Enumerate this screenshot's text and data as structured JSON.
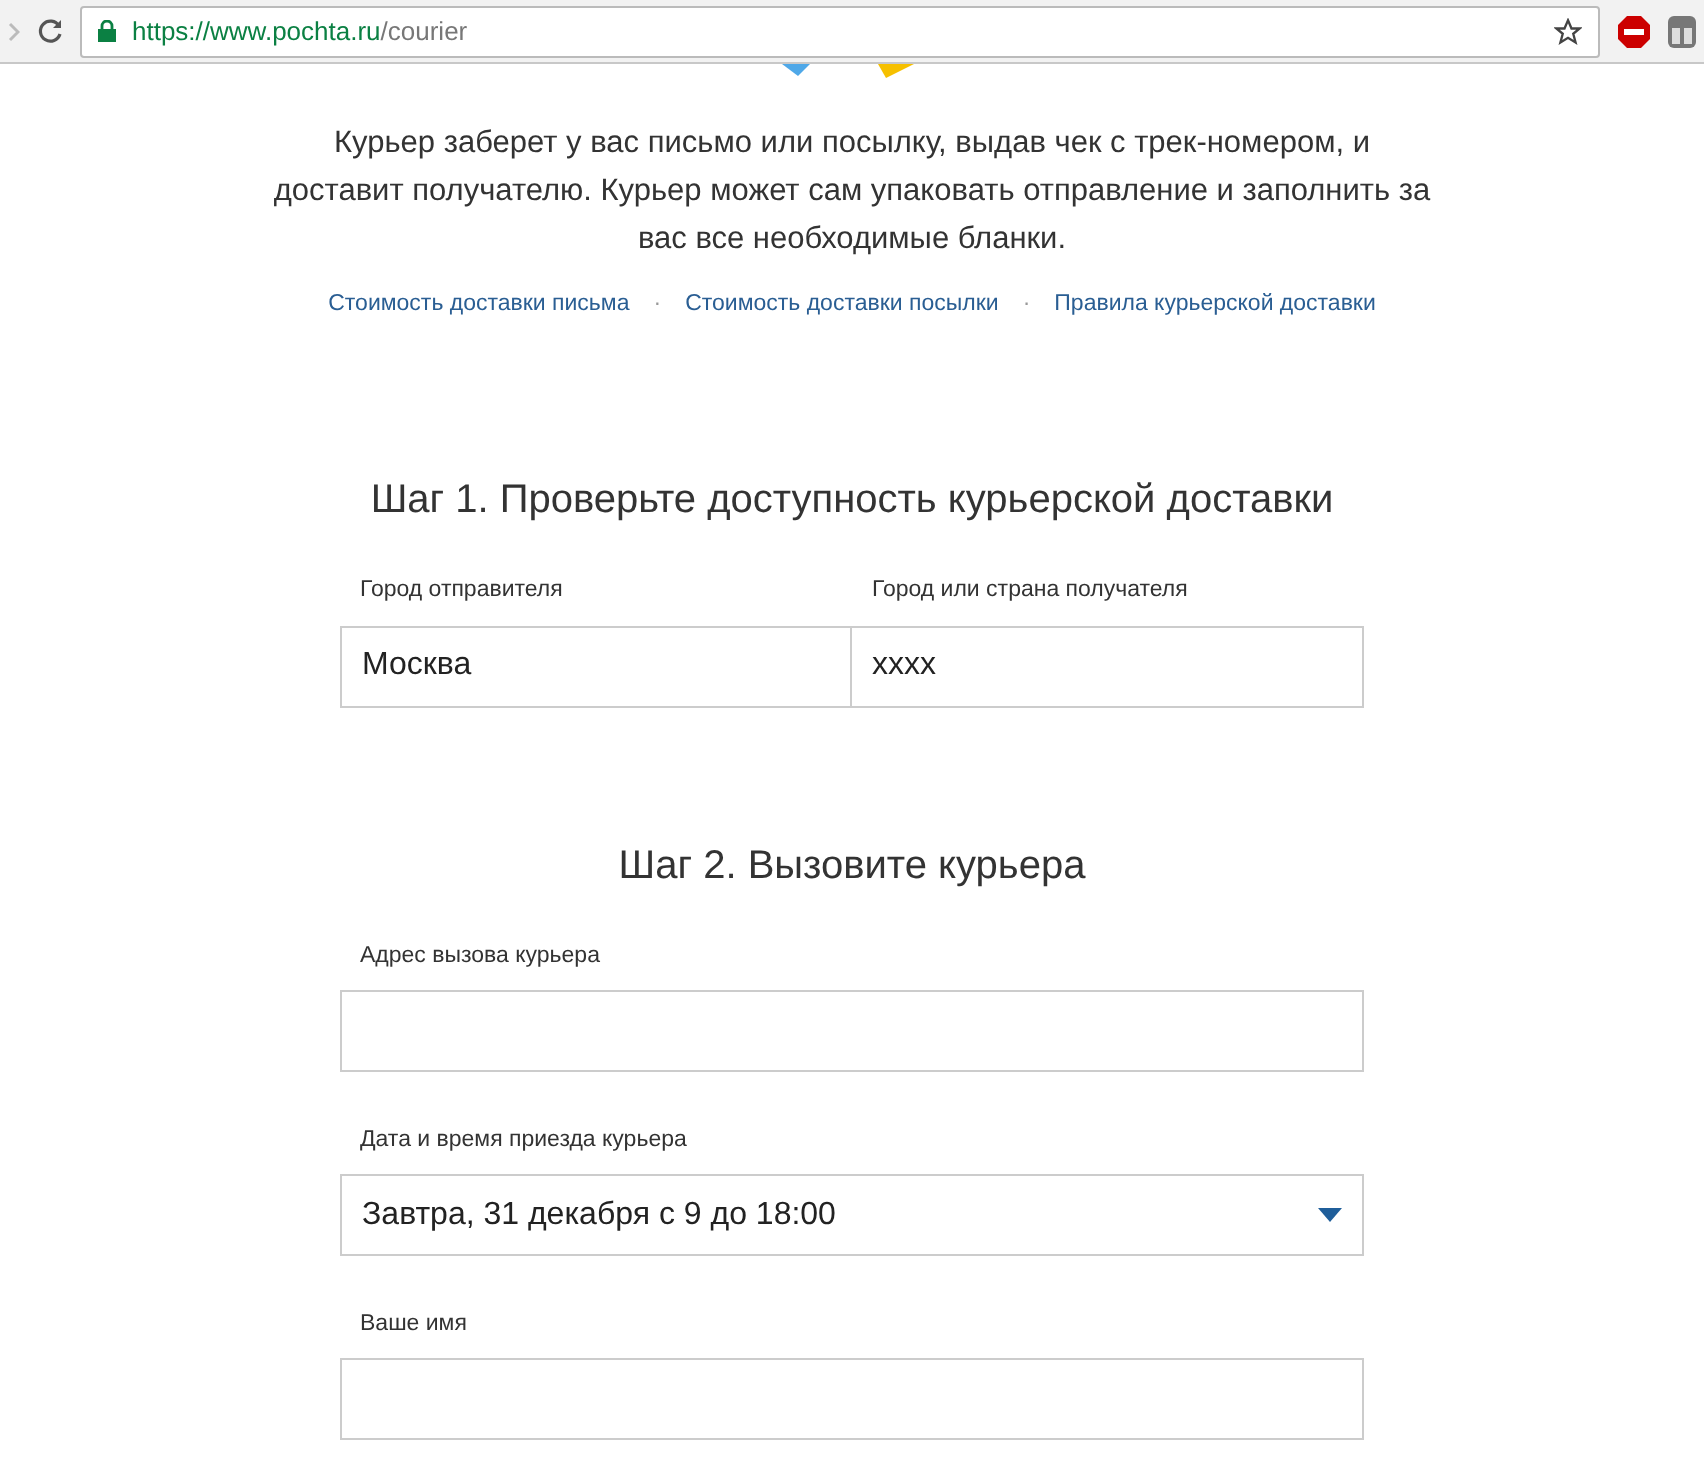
{
  "browser": {
    "url_host": "https://www.pochta.ru",
    "url_path": "/courier"
  },
  "intro": "Курьер заберет у вас письмо или посылку, выдав чек с трек-номером, и доставит получателю. Курьер может сам упаковать отправление и заполнить за вас все необходимые бланки.",
  "links": [
    "Стоимость доставки письма",
    "Стоимость доставки посылки",
    "Правила курьерской доставки"
  ],
  "separator": "·",
  "step1": {
    "title": "Шаг 1. Проверьте доступность курьерской доставки",
    "fields": [
      {
        "label": "Город отправителя",
        "value": "Москва"
      },
      {
        "label": "Город или страна получателя",
        "value": "xxxx"
      }
    ]
  },
  "step2": {
    "title": "Шаг 2. Вызовите курьера",
    "fields": [
      {
        "kind": "text",
        "label": "Адрес вызова курьера"
      },
      {
        "kind": "select",
        "label": "Дата и время приезда курьера",
        "value": "Завтра, 31 декабря с 9 до 18:00"
      },
      {
        "kind": "text",
        "label": "Ваше имя"
      }
    ]
  }
}
